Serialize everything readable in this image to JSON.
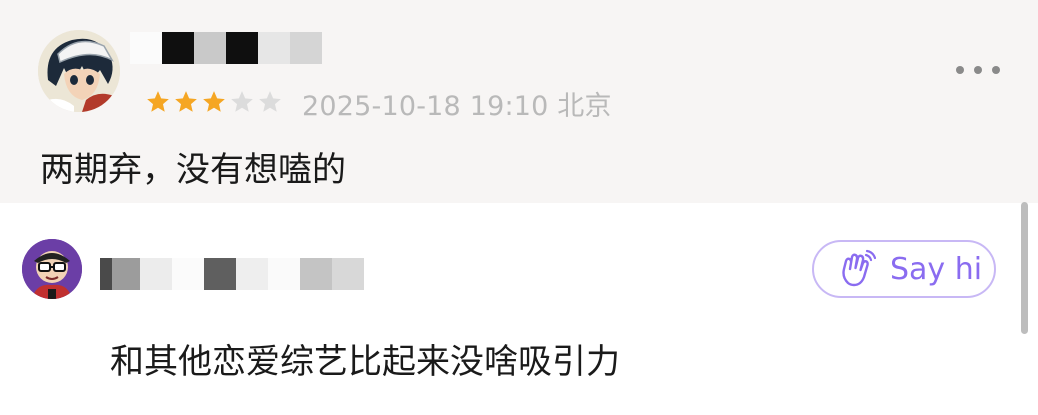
{
  "top_comment": {
    "avatar": "anime-avatar",
    "rating": {
      "filled": 3,
      "total": 5
    },
    "colors": {
      "star_filled": "#f5a623",
      "star_empty": "#dcdcdc",
      "background": "#f7f5f4"
    },
    "meta": "2025-10-18 19:10 北京",
    "more_icon": "more-horizontal-icon",
    "text": "两期弃，没有想嗑的"
  },
  "reply": {
    "avatar": "cartoon-avatar",
    "say_hi": {
      "label": "Say hi",
      "icon": "waving-hand-icon",
      "color": "#8a6cf0",
      "border": "#c8b8f5"
    },
    "text": "和其他恋爱综艺比起来没啥吸引力"
  }
}
